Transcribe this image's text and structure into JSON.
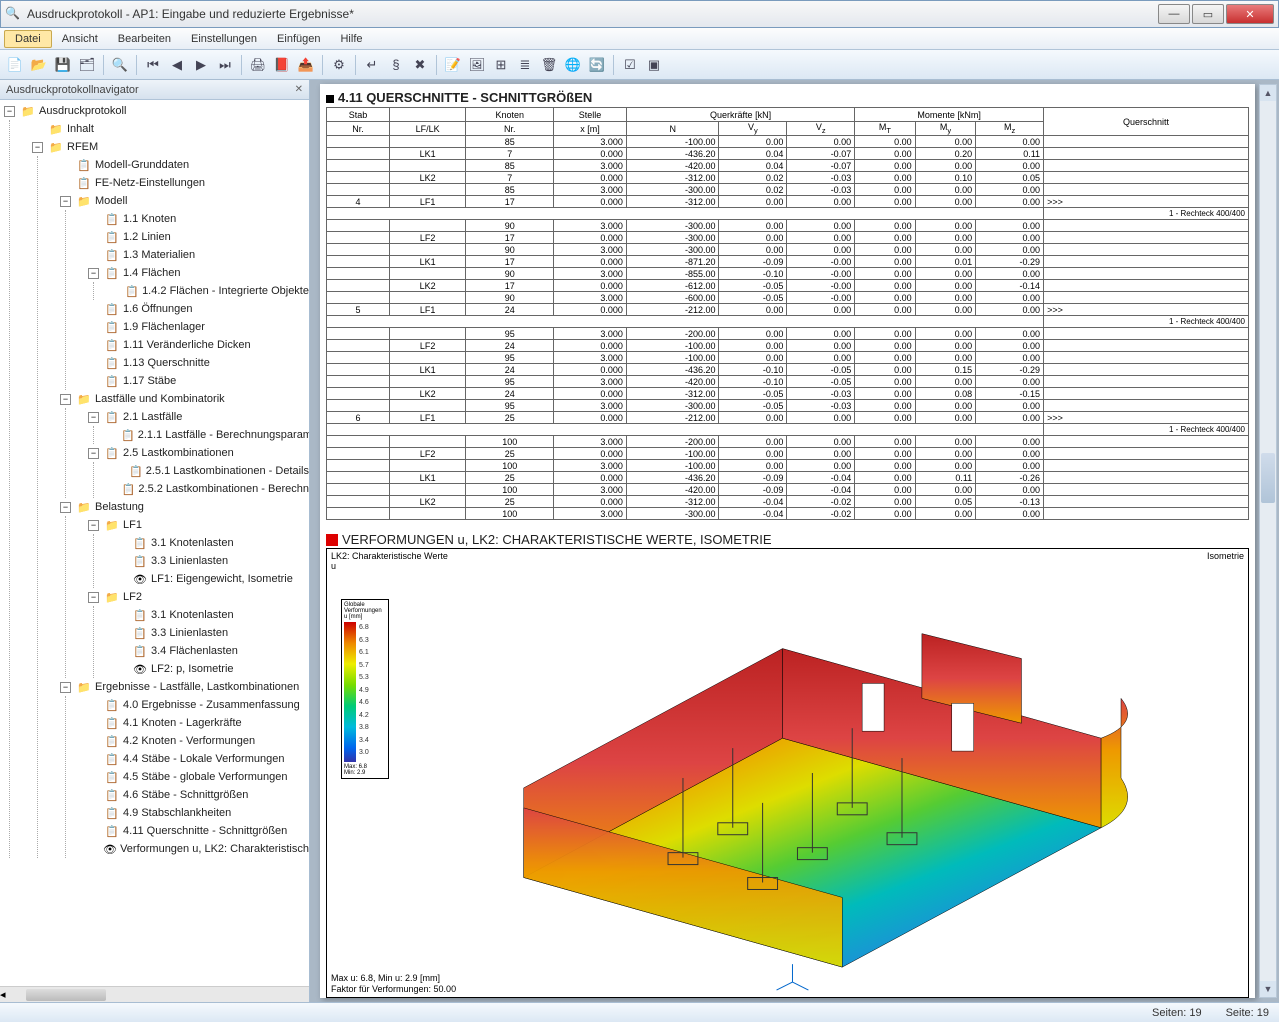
{
  "window": {
    "title": "Ausdruckprotokoll - AP1: Eingabe und reduzierte Ergebnisse*"
  },
  "menu": {
    "datei": "Datei",
    "ansicht": "Ansicht",
    "bearbeiten": "Bearbeiten",
    "einstellungen": "Einstellungen",
    "einfuegen": "Einfügen",
    "hilfe": "Hilfe"
  },
  "nav": {
    "title": "Ausdruckprotokollnavigator",
    "root": "Ausdruckprotokoll",
    "items": {
      "inhalt": "Inhalt",
      "rfem": "RFEM",
      "modell_grund": "Modell-Grunddaten",
      "fe_netz": "FE-Netz-Einstellungen",
      "modell": "Modell",
      "m11": "1.1 Knoten",
      "m12": "1.2 Linien",
      "m13": "1.3 Materialien",
      "m14": "1.4 Flächen",
      "m142": "1.4.2 Flächen - Integrierte Objekte",
      "m16": "1.6 Öffnungen",
      "m19": "1.9 Flächenlager",
      "m111": "1.11 Veränderliche Dicken",
      "m113": "1.13 Querschnitte",
      "m117": "1.17 Stäbe",
      "lastkomb": "Lastfälle und Kombinatorik",
      "l21": "2.1 Lastfälle",
      "l211": "2.1.1 Lastfälle - Berechnungsparam",
      "l25": "2.5 Lastkombinationen",
      "l251": "2.5.1 Lastkombinationen - Details",
      "l252": "2.5.2 Lastkombinationen - Berechn",
      "belastung": "Belastung",
      "lf1": "LF1",
      "b31a": "3.1 Knotenlasten",
      "b33a": "3.3 Linienlasten",
      "lf1iso": "LF1: Eigengewicht, Isometrie",
      "lf2": "LF2",
      "b31b": "3.1 Knotenlasten",
      "b33b": "3.3 Linienlasten",
      "b34b": "3.4 Flächenlasten",
      "lf2p": "LF2: p, Isometrie",
      "ergeb": "Ergebnisse - Lastfälle, Lastkombinationen",
      "e40": "4.0 Ergebnisse - Zusammenfassung",
      "e41": "4.1 Knoten - Lagerkräfte",
      "e42": "4.2 Knoten - Verformungen",
      "e44": "4.4 Stäbe - Lokale Verformungen",
      "e45": "4.5 Stäbe - globale Verformungen",
      "e46": "4.6 Stäbe - Schnittgrößen",
      "e49": "4.9 Stabschlankheiten",
      "e411": "4.11 Querschnitte - Schnittgrößen",
      "verf": "Verformungen u, LK2: Charakteristisch"
    }
  },
  "table": {
    "title": "4.11 QUERSCHNITTE - SCHNITTGRÖßEN",
    "headers": {
      "stab": "Stab",
      "nr": "Nr.",
      "lflk": "LF/LK",
      "knoten": "Knoten",
      "stelle": "Stelle",
      "xm": "x [m]",
      "querkraefte": "Querkräfte [kN]",
      "n": "N",
      "vy": "Vy",
      "vz": "Vz",
      "momente": "Momente [kNm]",
      "mt": "MT",
      "my": "My",
      "mz": "Mz",
      "querschnitt": "Querschnitt"
    },
    "note": "1 - Rechteck 400/400",
    "rows": [
      {
        "stab": "",
        "lf": "",
        "kn": "85",
        "x": "3.000",
        "n": "-100.00",
        "vy": "0.00",
        "vz": "0.00",
        "mt": "0.00",
        "my": "0.00",
        "mz": "0.00",
        "qs": ""
      },
      {
        "stab": "",
        "lf": "LK1",
        "kn": "7",
        "x": "0.000",
        "n": "-436.20",
        "vy": "0.04",
        "vz": "-0.07",
        "mt": "0.00",
        "my": "0.20",
        "mz": "0.11",
        "qs": ""
      },
      {
        "stab": "",
        "lf": "",
        "kn": "85",
        "x": "3.000",
        "n": "-420.00",
        "vy": "0.04",
        "vz": "-0.07",
        "mt": "0.00",
        "my": "0.00",
        "mz": "0.00",
        "qs": ""
      },
      {
        "stab": "",
        "lf": "LK2",
        "kn": "7",
        "x": "0.000",
        "n": "-312.00",
        "vy": "0.02",
        "vz": "-0.03",
        "mt": "0.00",
        "my": "0.10",
        "mz": "0.05",
        "qs": ""
      },
      {
        "stab": "",
        "lf": "",
        "kn": "85",
        "x": "3.000",
        "n": "-300.00",
        "vy": "0.02",
        "vz": "-0.03",
        "mt": "0.00",
        "my": "0.00",
        "mz": "0.00",
        "qs": ""
      },
      {
        "stab": "4",
        "lf": "LF1",
        "kn": "17",
        "x": "0.000",
        "n": "-312.00",
        "vy": "0.00",
        "vz": "0.00",
        "mt": "0.00",
        "my": "0.00",
        "mz": "0.00",
        "qs": ">>>",
        "div": true,
        "note": true
      },
      {
        "stab": "",
        "lf": "",
        "kn": "90",
        "x": "3.000",
        "n": "-300.00",
        "vy": "0.00",
        "vz": "0.00",
        "mt": "0.00",
        "my": "0.00",
        "mz": "0.00",
        "qs": ""
      },
      {
        "stab": "",
        "lf": "LF2",
        "kn": "17",
        "x": "0.000",
        "n": "-300.00",
        "vy": "0.00",
        "vz": "0.00",
        "mt": "0.00",
        "my": "0.00",
        "mz": "0.00",
        "qs": ""
      },
      {
        "stab": "",
        "lf": "",
        "kn": "90",
        "x": "3.000",
        "n": "-300.00",
        "vy": "0.00",
        "vz": "0.00",
        "mt": "0.00",
        "my": "0.00",
        "mz": "0.00",
        "qs": ""
      },
      {
        "stab": "",
        "lf": "LK1",
        "kn": "17",
        "x": "0.000",
        "n": "-871.20",
        "vy": "-0.09",
        "vz": "-0.00",
        "mt": "0.00",
        "my": "0.01",
        "mz": "-0.29",
        "qs": ""
      },
      {
        "stab": "",
        "lf": "",
        "kn": "90",
        "x": "3.000",
        "n": "-855.00",
        "vy": "-0.10",
        "vz": "-0.00",
        "mt": "0.00",
        "my": "0.00",
        "mz": "0.00",
        "qs": ""
      },
      {
        "stab": "",
        "lf": "LK2",
        "kn": "17",
        "x": "0.000",
        "n": "-612.00",
        "vy": "-0.05",
        "vz": "-0.00",
        "mt": "0.00",
        "my": "0.00",
        "mz": "-0.14",
        "qs": ""
      },
      {
        "stab": "",
        "lf": "",
        "kn": "90",
        "x": "3.000",
        "n": "-600.00",
        "vy": "-0.05",
        "vz": "-0.00",
        "mt": "0.00",
        "my": "0.00",
        "mz": "0.00",
        "qs": ""
      },
      {
        "stab": "5",
        "lf": "LF1",
        "kn": "24",
        "x": "0.000",
        "n": "-212.00",
        "vy": "0.00",
        "vz": "0.00",
        "mt": "0.00",
        "my": "0.00",
        "mz": "0.00",
        "qs": ">>>",
        "div": true,
        "note": true
      },
      {
        "stab": "",
        "lf": "",
        "kn": "95",
        "x": "3.000",
        "n": "-200.00",
        "vy": "0.00",
        "vz": "0.00",
        "mt": "0.00",
        "my": "0.00",
        "mz": "0.00",
        "qs": ""
      },
      {
        "stab": "",
        "lf": "LF2",
        "kn": "24",
        "x": "0.000",
        "n": "-100.00",
        "vy": "0.00",
        "vz": "0.00",
        "mt": "0.00",
        "my": "0.00",
        "mz": "0.00",
        "qs": ""
      },
      {
        "stab": "",
        "lf": "",
        "kn": "95",
        "x": "3.000",
        "n": "-100.00",
        "vy": "0.00",
        "vz": "0.00",
        "mt": "0.00",
        "my": "0.00",
        "mz": "0.00",
        "qs": ""
      },
      {
        "stab": "",
        "lf": "LK1",
        "kn": "24",
        "x": "0.000",
        "n": "-436.20",
        "vy": "-0.10",
        "vz": "-0.05",
        "mt": "0.00",
        "my": "0.15",
        "mz": "-0.29",
        "qs": ""
      },
      {
        "stab": "",
        "lf": "",
        "kn": "95",
        "x": "3.000",
        "n": "-420.00",
        "vy": "-0.10",
        "vz": "-0.05",
        "mt": "0.00",
        "my": "0.00",
        "mz": "0.00",
        "qs": ""
      },
      {
        "stab": "",
        "lf": "LK2",
        "kn": "24",
        "x": "0.000",
        "n": "-312.00",
        "vy": "-0.05",
        "vz": "-0.03",
        "mt": "0.00",
        "my": "0.08",
        "mz": "-0.15",
        "qs": ""
      },
      {
        "stab": "",
        "lf": "",
        "kn": "95",
        "x": "3.000",
        "n": "-300.00",
        "vy": "-0.05",
        "vz": "-0.03",
        "mt": "0.00",
        "my": "0.00",
        "mz": "0.00",
        "qs": ""
      },
      {
        "stab": "6",
        "lf": "LF1",
        "kn": "25",
        "x": "0.000",
        "n": "-212.00",
        "vy": "0.00",
        "vz": "0.00",
        "mt": "0.00",
        "my": "0.00",
        "mz": "0.00",
        "qs": ">>>",
        "div": true,
        "note": true
      },
      {
        "stab": "",
        "lf": "",
        "kn": "100",
        "x": "3.000",
        "n": "-200.00",
        "vy": "0.00",
        "vz": "0.00",
        "mt": "0.00",
        "my": "0.00",
        "mz": "0.00",
        "qs": ""
      },
      {
        "stab": "",
        "lf": "LF2",
        "kn": "25",
        "x": "0.000",
        "n": "-100.00",
        "vy": "0.00",
        "vz": "0.00",
        "mt": "0.00",
        "my": "0.00",
        "mz": "0.00",
        "qs": ""
      },
      {
        "stab": "",
        "lf": "",
        "kn": "100",
        "x": "3.000",
        "n": "-100.00",
        "vy": "0.00",
        "vz": "0.00",
        "mt": "0.00",
        "my": "0.00",
        "mz": "0.00",
        "qs": ""
      },
      {
        "stab": "",
        "lf": "LK1",
        "kn": "25",
        "x": "0.000",
        "n": "-436.20",
        "vy": "-0.09",
        "vz": "-0.04",
        "mt": "0.00",
        "my": "0.11",
        "mz": "-0.26",
        "qs": ""
      },
      {
        "stab": "",
        "lf": "",
        "kn": "100",
        "x": "3.000",
        "n": "-420.00",
        "vy": "-0.09",
        "vz": "-0.04",
        "mt": "0.00",
        "my": "0.00",
        "mz": "0.00",
        "qs": ""
      },
      {
        "stab": "",
        "lf": "LK2",
        "kn": "25",
        "x": "0.000",
        "n": "-312.00",
        "vy": "-0.04",
        "vz": "-0.02",
        "mt": "0.00",
        "my": "0.05",
        "mz": "-0.13",
        "qs": ""
      },
      {
        "stab": "",
        "lf": "",
        "kn": "100",
        "x": "3.000",
        "n": "-300.00",
        "vy": "-0.04",
        "vz": "-0.02",
        "mt": "0.00",
        "my": "0.00",
        "mz": "0.00",
        "qs": ""
      }
    ]
  },
  "figure": {
    "title": "VERFORMUNGEN u, LK2: CHARAKTERISTISCHE WERTE, ISOMETRIE",
    "tl_line1": "LK2: Charakteristische Werte",
    "tl_line2": "u",
    "tr": "Isometrie",
    "bl_line1": "Max u: 6.8, Min u: 2.9 [mm]",
    "bl_line2": "Faktor für Verformungen: 50.00",
    "legend_title": "Globale Verformungen",
    "legend_unit": "u [mm]",
    "legend_vals": [
      "6.8",
      "6.3",
      "6.1",
      "5.7",
      "5.3",
      "4.9",
      "4.6",
      "4.2",
      "3.8",
      "3.4",
      "3.0"
    ],
    "legend_max": "6.8",
    "legend_min": "2.9"
  },
  "status": {
    "seiten": "Seiten:  19",
    "seite": "Seite:  19"
  }
}
